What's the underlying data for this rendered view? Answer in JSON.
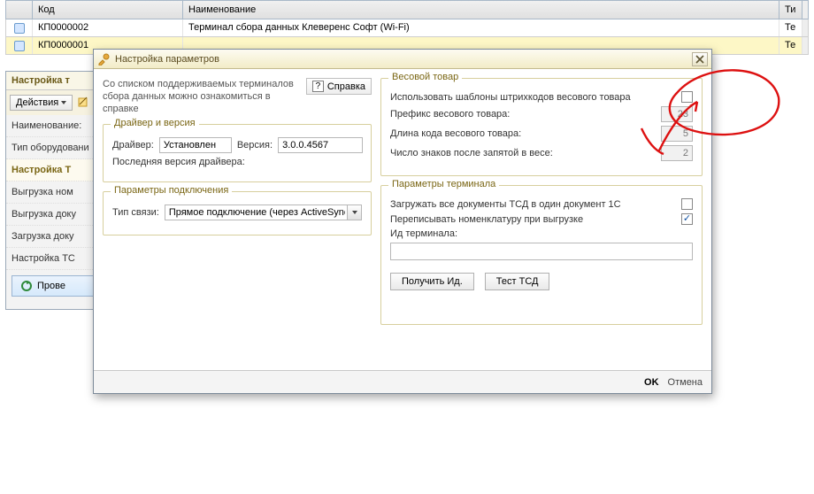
{
  "grid": {
    "headers": {
      "code": "Код",
      "name": "Наименование",
      "ti": "Ти"
    },
    "rows": [
      {
        "code": "КП0000002",
        "name": "Терминал сбора данных Клеверенс Софт (Wi-Fi)",
        "ti": "Те"
      },
      {
        "code": "КП0000001",
        "name": "",
        "ti": "Те"
      }
    ]
  },
  "side": {
    "title": "Настройка т",
    "actions": "Действия",
    "name_label": "Наименование:",
    "eq_label": "Тип оборудовани",
    "group_title": "Настройка Т",
    "items": {
      "upload_nom": "Выгрузка ном",
      "upload_doc": "Выгрузка доку",
      "download_doc": "Загрузка доку",
      "settings_ts": "Настройка ТС"
    },
    "check_btn": "Прове"
  },
  "dialog": {
    "title": "Настройка параметров",
    "info": "Со списком поддерживаемых терминалов сбора данных можно ознакомиться в справке",
    "help": "Справка",
    "driver_group": "Драйвер и версия",
    "driver_label": "Драйвер:",
    "driver_status": "Установлен",
    "version_label": "Версия:",
    "version_value": "3.0.0.4567",
    "last_version_label": "Последняя версия драйвера:",
    "conn_group": "Параметры подключения",
    "conn_type_label": "Тип связи:",
    "conn_type_value": "Прямое подключение (через ActiveSync)",
    "weight_group": "Весовой товар",
    "use_templates": "Использовать шаблоны штрихкодов весового товара",
    "prefix_label": "Префикс весового товара:",
    "prefix_value": "23",
    "code_len_label": "Длина кода весового товара:",
    "code_len_value": "5",
    "decimals_label": "Число знаков после запятой в весе:",
    "decimals_value": "2",
    "term_group": "Параметры терминала",
    "load_all": "Загружать все документы ТСД в один документ 1С",
    "overwrite": "Переписывать номенклатуру при выгрузке",
    "id_label": "Ид терминала:",
    "get_id": "Получить Ид.",
    "test": "Тест ТСД",
    "ok": "OK",
    "cancel": "Отмена"
  }
}
